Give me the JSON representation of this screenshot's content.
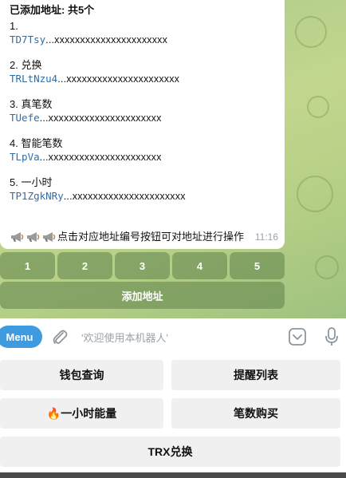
{
  "message": {
    "title": "已添加地址: 共5个",
    "entries": [
      {
        "label": "1.",
        "addr": "TD7Tsy",
        "mask": "...xxxxxxxxxxxxxxxxxxxxxx"
      },
      {
        "label": "2. 兑换",
        "addr": "TRLtNzu4",
        "mask": "...xxxxxxxxxxxxxxxxxxxxxx"
      },
      {
        "label": "3. 真笔数",
        "addr": "TUefe",
        "mask": "...xxxxxxxxxxxxxxxxxxxxxx"
      },
      {
        "label": "4. 智能笔数",
        "addr": "TLpVa",
        "mask": "...xxxxxxxxxxxxxxxxxxxxxx"
      },
      {
        "label": "5. 一小时",
        "addr": "TP1ZgkNRy",
        "mask": "...xxxxxxxxxxxxxxxxxxxxxx"
      }
    ],
    "footer_text": "点击对应地址编号按钮可对地址进行操作",
    "time": "11:16"
  },
  "inline_keyboard": {
    "numbers": [
      "1",
      "2",
      "3",
      "4",
      "5"
    ],
    "add_label": "添加地址"
  },
  "input_bar": {
    "menu_label": "Menu",
    "placeholder": "'欢迎使用本机器人'"
  },
  "reply_keyboard": {
    "wallet_query": "钱包查询",
    "reminder_list": "提醒列表",
    "hour_energy": "🔥一小时能量",
    "count_buy": "笔数购买",
    "trx_exchange": "TRX兑换"
  },
  "colors": {
    "accent": "#3f9be0",
    "address": "#2f6ea5",
    "chat_bg": "#b6cf86"
  }
}
